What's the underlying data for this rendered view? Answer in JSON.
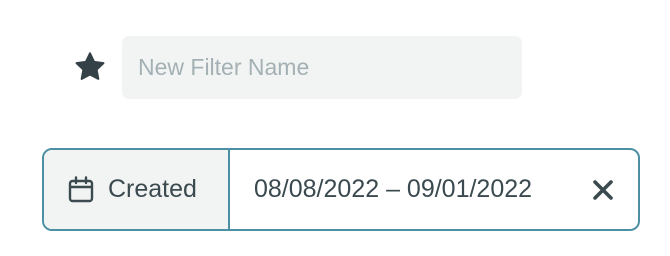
{
  "filter_name": {
    "placeholder": "New Filter Name",
    "value": ""
  },
  "date_filter": {
    "field_label": "Created",
    "range_text": "08/08/2022 – 09/01/2022"
  },
  "icons": {
    "favorite": "star-icon",
    "field": "calendar-icon",
    "clear": "close-icon"
  },
  "colors": {
    "accent_border": "#4d8fa3",
    "text": "#3b4a4f",
    "placeholder": "#a4b0b3",
    "input_background": "#f2f4f4"
  }
}
